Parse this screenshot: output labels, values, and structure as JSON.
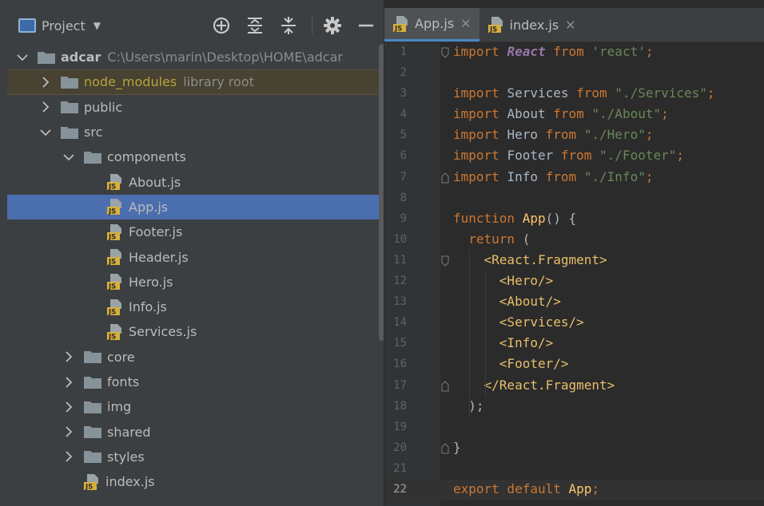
{
  "project_panel": {
    "title": "Project",
    "header_icons": [
      "crosshair-icon",
      "expand-all-icon",
      "collapse-all-icon",
      "gear-icon",
      "minimize-icon"
    ],
    "tree": [
      {
        "depth": 0,
        "type": "folder",
        "expanded": true,
        "name": "adcar",
        "hint": "C:\\Users\\marin\\Desktop\\HOME\\adcar",
        "bold": true
      },
      {
        "depth": 1,
        "type": "folder",
        "expanded": false,
        "name": "node_modules",
        "hint": "library root",
        "library": true
      },
      {
        "depth": 1,
        "type": "folder",
        "expanded": false,
        "name": "public"
      },
      {
        "depth": 1,
        "type": "folder",
        "expanded": true,
        "name": "src"
      },
      {
        "depth": 2,
        "type": "folder",
        "expanded": true,
        "name": "components"
      },
      {
        "depth": 3,
        "type": "js",
        "name": "About.js"
      },
      {
        "depth": 3,
        "type": "js",
        "name": "App.js",
        "selected": true
      },
      {
        "depth": 3,
        "type": "js",
        "name": "Footer.js"
      },
      {
        "depth": 3,
        "type": "js",
        "name": "Header.js"
      },
      {
        "depth": 3,
        "type": "js",
        "name": "Hero.js"
      },
      {
        "depth": 3,
        "type": "js",
        "name": "Info.js"
      },
      {
        "depth": 3,
        "type": "js",
        "name": "Services.js"
      },
      {
        "depth": 2,
        "type": "folder",
        "expanded": false,
        "name": "core"
      },
      {
        "depth": 2,
        "type": "folder",
        "expanded": false,
        "name": "fonts"
      },
      {
        "depth": 2,
        "type": "folder",
        "expanded": false,
        "name": "img"
      },
      {
        "depth": 2,
        "type": "folder",
        "expanded": false,
        "name": "shared"
      },
      {
        "depth": 2,
        "type": "folder",
        "expanded": false,
        "name": "styles"
      },
      {
        "depth": 2,
        "type": "js",
        "name": "index.js"
      }
    ]
  },
  "editor": {
    "tabs": [
      {
        "label": "App.js",
        "active": true
      },
      {
        "label": "index.js",
        "active": false
      }
    ],
    "close_glyph": "✕",
    "current_line": 22,
    "lines": [
      {
        "n": "1",
        "fold": "open",
        "tokens": [
          [
            "kw",
            "import "
          ],
          [
            "react",
            "React"
          ],
          [
            "kw",
            " from "
          ],
          [
            "str",
            "'react'"
          ],
          [
            "kw",
            ";"
          ]
        ]
      },
      {
        "n": "2",
        "tokens": []
      },
      {
        "n": "3",
        "tokens": [
          [
            "kw",
            "import "
          ],
          [
            "plain",
            "Services"
          ],
          [
            "kw",
            " from "
          ],
          [
            "str",
            "\"./Services\""
          ],
          [
            "kw",
            ";"
          ]
        ]
      },
      {
        "n": "4",
        "tokens": [
          [
            "kw",
            "import "
          ],
          [
            "plain",
            "About"
          ],
          [
            "kw",
            " from "
          ],
          [
            "str",
            "\"./About\""
          ],
          [
            "kw",
            ";"
          ]
        ]
      },
      {
        "n": "5",
        "tokens": [
          [
            "kw",
            "import "
          ],
          [
            "plain",
            "Hero"
          ],
          [
            "kw",
            " from "
          ],
          [
            "str",
            "\"./Hero\""
          ],
          [
            "kw",
            ";"
          ]
        ]
      },
      {
        "n": "6",
        "tokens": [
          [
            "kw",
            "import "
          ],
          [
            "plain",
            "Footer"
          ],
          [
            "kw",
            " from "
          ],
          [
            "str",
            "\"./Footer\""
          ],
          [
            "kw",
            ";"
          ]
        ]
      },
      {
        "n": "7",
        "fold": "close",
        "tokens": [
          [
            "kw",
            "import "
          ],
          [
            "plain",
            "Info"
          ],
          [
            "kw",
            " from "
          ],
          [
            "str",
            "\"./Info\""
          ],
          [
            "kw",
            ";"
          ]
        ]
      },
      {
        "n": "8",
        "tokens": []
      },
      {
        "n": "9",
        "tokens": [
          [
            "kw",
            "function "
          ],
          [
            "fn",
            "App"
          ],
          [
            "plain",
            "() {"
          ]
        ]
      },
      {
        "n": "10",
        "tokens": [
          [
            "plain",
            "  "
          ],
          [
            "kw",
            "return "
          ],
          [
            "plain",
            "("
          ]
        ]
      },
      {
        "n": "11",
        "fold": "open",
        "tokens": [
          [
            "plain",
            "    "
          ],
          [
            "tag",
            "<React.Fragment>"
          ]
        ]
      },
      {
        "n": "12",
        "tokens": [
          [
            "plain",
            "      "
          ],
          [
            "tag",
            "<Hero/>"
          ]
        ]
      },
      {
        "n": "13",
        "tokens": [
          [
            "plain",
            "      "
          ],
          [
            "tag",
            "<About/>"
          ]
        ]
      },
      {
        "n": "14",
        "tokens": [
          [
            "plain",
            "      "
          ],
          [
            "tag",
            "<Services/>"
          ]
        ]
      },
      {
        "n": "15",
        "tokens": [
          [
            "plain",
            "      "
          ],
          [
            "tag",
            "<Info/>"
          ]
        ]
      },
      {
        "n": "16",
        "tokens": [
          [
            "plain",
            "      "
          ],
          [
            "tag",
            "<Footer/>"
          ]
        ]
      },
      {
        "n": "17",
        "fold": "close",
        "tokens": [
          [
            "plain",
            "    "
          ],
          [
            "tag",
            "</React.Fragment>"
          ]
        ]
      },
      {
        "n": "18",
        "tokens": [
          [
            "plain",
            "  );"
          ]
        ]
      },
      {
        "n": "19",
        "tokens": []
      },
      {
        "n": "20",
        "fold": "close",
        "tokens": [
          [
            "plain",
            "}"
          ]
        ]
      },
      {
        "n": "21",
        "tokens": []
      },
      {
        "n": "22",
        "tokens": [
          [
            "kw",
            "export default "
          ],
          [
            "fn",
            "App"
          ],
          [
            "kw",
            ";"
          ]
        ]
      }
    ]
  },
  "colors": {
    "keyword": "#cc7832",
    "string": "#6a8759",
    "react": "#9876aa",
    "function": "#ffc66d",
    "tag": "#e8bf6a",
    "selection": "#4b6eaf",
    "folder": "#87939a",
    "js_badge": "#d7b03c"
  }
}
